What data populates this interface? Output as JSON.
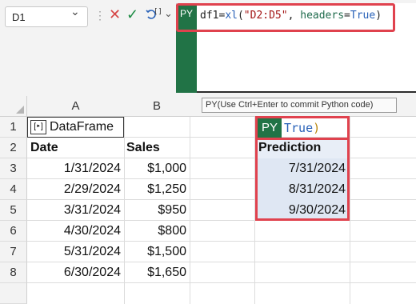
{
  "name_box": {
    "value": "D1"
  },
  "formula_bar": {
    "badge": "PY",
    "var": "df1",
    "eq": "=",
    "func": "xl",
    "paren_open": "(",
    "range": "\"D2:D5\"",
    "comma": ", ",
    "kw": "headers",
    "kw_eq": "=",
    "kw_val": "True",
    "paren_close": ")"
  },
  "tooltip": "PY(Use Ctrl+Enter to commit Python code)",
  "columns": [
    "A",
    "B"
  ],
  "rows": [
    "1",
    "2",
    "3",
    "4",
    "5",
    "6",
    "7",
    "8"
  ],
  "a1": {
    "label": "DataFrame"
  },
  "headers": {
    "date": "Date",
    "sales": "Sales",
    "prediction": "Prediction"
  },
  "data": [
    {
      "date": "1/31/2024",
      "sales": "$1,000"
    },
    {
      "date": "2/29/2024",
      "sales": "$1,250"
    },
    {
      "date": "3/31/2024",
      "sales": "$950"
    },
    {
      "date": "4/30/2024",
      "sales": "$800"
    },
    {
      "date": "5/31/2024",
      "sales": "$1,500"
    },
    {
      "date": "6/30/2024",
      "sales": "$1,650"
    }
  ],
  "predictions": [
    "7/31/2024",
    "8/31/2024",
    "9/30/2024"
  ],
  "d1_cell": {
    "badge": "PY",
    "value": "True",
    "paren": ")"
  },
  "colors": {
    "excel_green": "#217346",
    "highlight_red": "#e0424e",
    "selection_blue": "#dfe7f3"
  }
}
